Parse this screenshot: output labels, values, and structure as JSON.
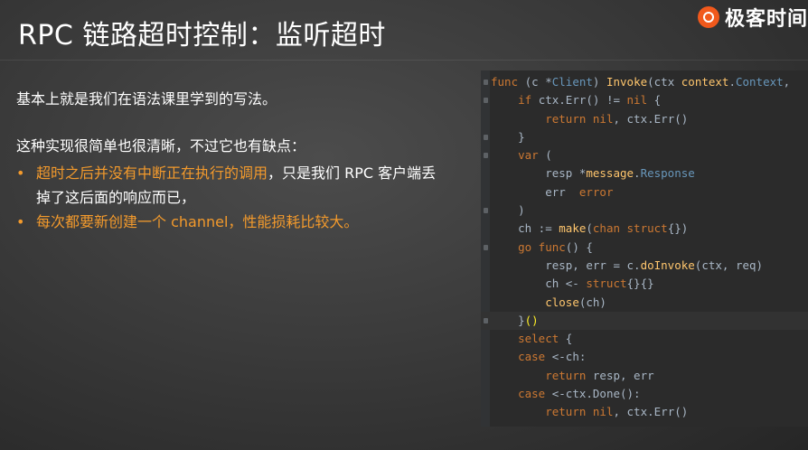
{
  "slide": {
    "title": "RPC 链路超时控制：监听超时",
    "logo_text": "极客时间"
  },
  "body": {
    "intro": "基本上就是我们在语法课里学到的写法。",
    "lead": "这种实现很简单也很清晰，不过它也有缺点：",
    "bullets": [
      {
        "marker": "•",
        "highlight": "超时之后并没有中断正在执行的调用",
        "rest": "，只是我们 RPC 客户端丢掉了这后面的响应而已，"
      },
      {
        "marker": "•",
        "highlight": "每次都要新创建一个 channel，性能损耗比较大。",
        "rest": ""
      }
    ]
  },
  "code": {
    "language": "go",
    "lines": [
      [
        {
          "t": "func ",
          "c": "kw"
        },
        {
          "t": "(c *",
          "c": "id"
        },
        {
          "t": "Client",
          "c": "ty"
        },
        {
          "t": ") ",
          "c": "id"
        },
        {
          "t": "Invoke",
          "c": "fn"
        },
        {
          "t": "(ctx ",
          "c": "id"
        },
        {
          "t": "context",
          "c": "fn"
        },
        {
          "t": ".",
          "c": "id"
        },
        {
          "t": "Context",
          "c": "ty"
        },
        {
          "t": ",",
          "c": "id"
        }
      ],
      [
        {
          "t": "    ",
          "c": "id"
        },
        {
          "t": "if ",
          "c": "kw"
        },
        {
          "t": "ctx.Err() != ",
          "c": "id"
        },
        {
          "t": "nil",
          "c": "kw"
        },
        {
          "t": " {",
          "c": "id"
        }
      ],
      [
        {
          "t": "        ",
          "c": "id"
        },
        {
          "t": "return nil",
          "c": "kw"
        },
        {
          "t": ", ctx.Err()",
          "c": "id"
        }
      ],
      [
        {
          "t": "    }",
          "c": "id"
        }
      ],
      [
        {
          "t": "    ",
          "c": "id"
        },
        {
          "t": "var",
          "c": "kw"
        },
        {
          "t": " (",
          "c": "id"
        }
      ],
      [
        {
          "t": "        resp *",
          "c": "id"
        },
        {
          "t": "message",
          "c": "fn"
        },
        {
          "t": ".",
          "c": "id"
        },
        {
          "t": "Response",
          "c": "ty"
        }
      ],
      [
        {
          "t": "        err  ",
          "c": "id"
        },
        {
          "t": "error",
          "c": "kw"
        }
      ],
      [
        {
          "t": "    )",
          "c": "id"
        }
      ],
      [
        {
          "t": "    ch := ",
          "c": "id"
        },
        {
          "t": "make",
          "c": "fn"
        },
        {
          "t": "(",
          "c": "id"
        },
        {
          "t": "chan struct",
          "c": "kw"
        },
        {
          "t": "{})",
          "c": "id"
        }
      ],
      [
        {
          "t": "    ",
          "c": "id"
        },
        {
          "t": "go func",
          "c": "kw"
        },
        {
          "t": "() {",
          "c": "id"
        }
      ],
      [
        {
          "t": "        resp, err = c.",
          "c": "id"
        },
        {
          "t": "doInvoke",
          "c": "fn"
        },
        {
          "t": "(ctx, req)",
          "c": "id"
        }
      ],
      [
        {
          "t": "        ch <- ",
          "c": "id"
        },
        {
          "t": "struct",
          "c": "kw"
        },
        {
          "t": "{}{}",
          "c": "id"
        }
      ],
      [
        {
          "t": "        ",
          "c": "id"
        },
        {
          "t": "close",
          "c": "fn"
        },
        {
          "t": "(ch)",
          "c": "id"
        }
      ],
      [
        {
          "t": "    }",
          "c": "id"
        },
        {
          "t": "()",
          "c": "brace"
        }
      ],
      [
        {
          "t": "    ",
          "c": "id"
        },
        {
          "t": "select",
          "c": "kw"
        },
        {
          "t": " {",
          "c": "id"
        }
      ],
      [
        {
          "t": "    ",
          "c": "id"
        },
        {
          "t": "case",
          "c": "kw"
        },
        {
          "t": " <-ch:",
          "c": "id"
        }
      ],
      [
        {
          "t": "        ",
          "c": "id"
        },
        {
          "t": "return",
          "c": "kw"
        },
        {
          "t": " resp, err",
          "c": "id"
        }
      ],
      [
        {
          "t": "    ",
          "c": "id"
        },
        {
          "t": "case",
          "c": "kw"
        },
        {
          "t": " <-ctx.Done():",
          "c": "id"
        }
      ],
      [
        {
          "t": "        ",
          "c": "id"
        },
        {
          "t": "return nil",
          "c": "kw"
        },
        {
          "t": ", ctx.Err()",
          "c": "id"
        }
      ]
    ],
    "current_line": 13,
    "fold_marks": [
      0,
      1,
      3,
      4,
      7,
      9,
      13
    ]
  },
  "colors": {
    "accent_orange": "#f39a2c",
    "keyword": "#cc7832",
    "function": "#ffc66d",
    "type": "#6897bb",
    "identifier": "#a9b7c6",
    "brace_match": "#ffef28",
    "code_background": "#2b2b2b",
    "logo_orange": "#f1591c"
  }
}
